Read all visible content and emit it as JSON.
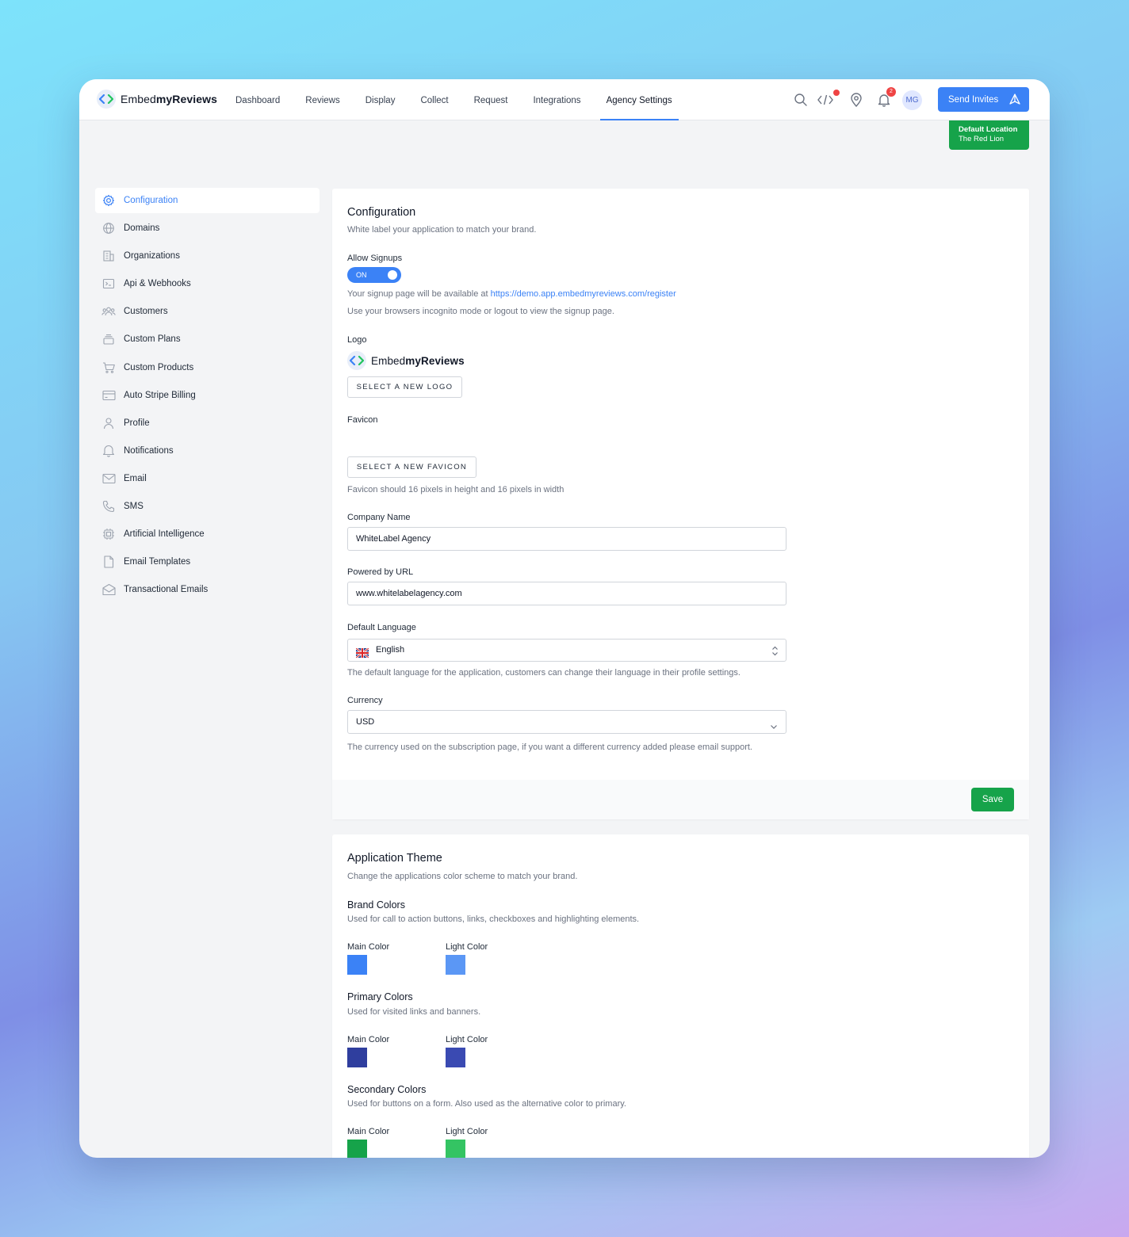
{
  "brand": {
    "name_regular": "Embed",
    "name_bold": "myReviews"
  },
  "nav": {
    "items": [
      {
        "label": "Dashboard"
      },
      {
        "label": "Reviews"
      },
      {
        "label": "Display"
      },
      {
        "label": "Collect"
      },
      {
        "label": "Request"
      },
      {
        "label": "Integrations"
      },
      {
        "label": "Agency Settings",
        "active": true
      }
    ]
  },
  "header": {
    "notification_count": "2",
    "avatar_initials": "MG",
    "send_invites_label": "Send Invites"
  },
  "location": {
    "label": "Default Location",
    "name": "The Red Lion"
  },
  "sidebar": {
    "items": [
      {
        "label": "Configuration",
        "icon": "gear-icon",
        "active": true
      },
      {
        "label": "Domains",
        "icon": "globe-icon"
      },
      {
        "label": "Organizations",
        "icon": "building-icon"
      },
      {
        "label": "Api & Webhooks",
        "icon": "terminal-icon"
      },
      {
        "label": "Customers",
        "icon": "users-icon"
      },
      {
        "label": "Custom Plans",
        "icon": "stack-icon"
      },
      {
        "label": "Custom Products",
        "icon": "cart-icon"
      },
      {
        "label": "Auto Stripe Billing",
        "icon": "credit-card-icon"
      },
      {
        "label": "Profile",
        "icon": "user-icon"
      },
      {
        "label": "Notifications",
        "icon": "bell-icon"
      },
      {
        "label": "Email",
        "icon": "mail-icon"
      },
      {
        "label": "SMS",
        "icon": "phone-icon"
      },
      {
        "label": "Artificial Intelligence",
        "icon": "chip-icon"
      },
      {
        "label": "Email Templates",
        "icon": "document-icon"
      },
      {
        "label": "Transactional Emails",
        "icon": "mail-open-icon"
      }
    ]
  },
  "config": {
    "title": "Configuration",
    "subtitle": "White label your application to match your brand.",
    "allow_signups_label": "Allow Signups",
    "toggle_label": "ON",
    "signup_text": "Your signup page will be available at ",
    "signup_url": "https://demo.app.embedmyreviews.com/register",
    "incognito_text": "Use your browsers incognito mode or logout to view the signup page.",
    "logo_label": "Logo",
    "select_logo_label": "SELECT A NEW LOGO",
    "favicon_label": "Favicon",
    "select_favicon_label": "SELECT A NEW FAVICON",
    "favicon_hint": "Favicon should 16 pixels in height and 16 pixels in width",
    "company_name_label": "Company Name",
    "company_name_value": "WhiteLabel Agency",
    "powered_by_label": "Powered by URL",
    "powered_by_value": "www.whitelabelagency.com",
    "language_label": "Default Language",
    "language_value": "English",
    "language_hint": "The default language for the application, customers can change their language in their profile settings.",
    "currency_label": "Currency",
    "currency_value": "USD",
    "currency_hint": "The currency used on the subscription page, if you want a different currency added please email support.",
    "save_label": "Save"
  },
  "theme": {
    "title": "Application Theme",
    "subtitle": "Change the applications color scheme to match your brand.",
    "groups": [
      {
        "title": "Brand Colors",
        "desc": "Used for call to action buttons, links, checkboxes and highlighting elements.",
        "main_label": "Main Color",
        "light_label": "Light Color",
        "main": "#3b82f6",
        "light": "#5b97f5"
      },
      {
        "title": "Primary Colors",
        "desc": "Used for visited links and banners.",
        "main_label": "Main Color",
        "light_label": "Light Color",
        "main": "#2f3e9e",
        "light": "#3a4ab2"
      },
      {
        "title": "Secondary Colors",
        "desc": "Used for buttons on a form. Also used as the alternative color to primary.",
        "main_label": "Main Color",
        "light_label": "Light Color",
        "main": "#16a34a",
        "light": "#34c463"
      }
    ]
  },
  "colors": {
    "accent": "#3b82f6",
    "success": "#16a34a",
    "danger": "#ef4444"
  }
}
